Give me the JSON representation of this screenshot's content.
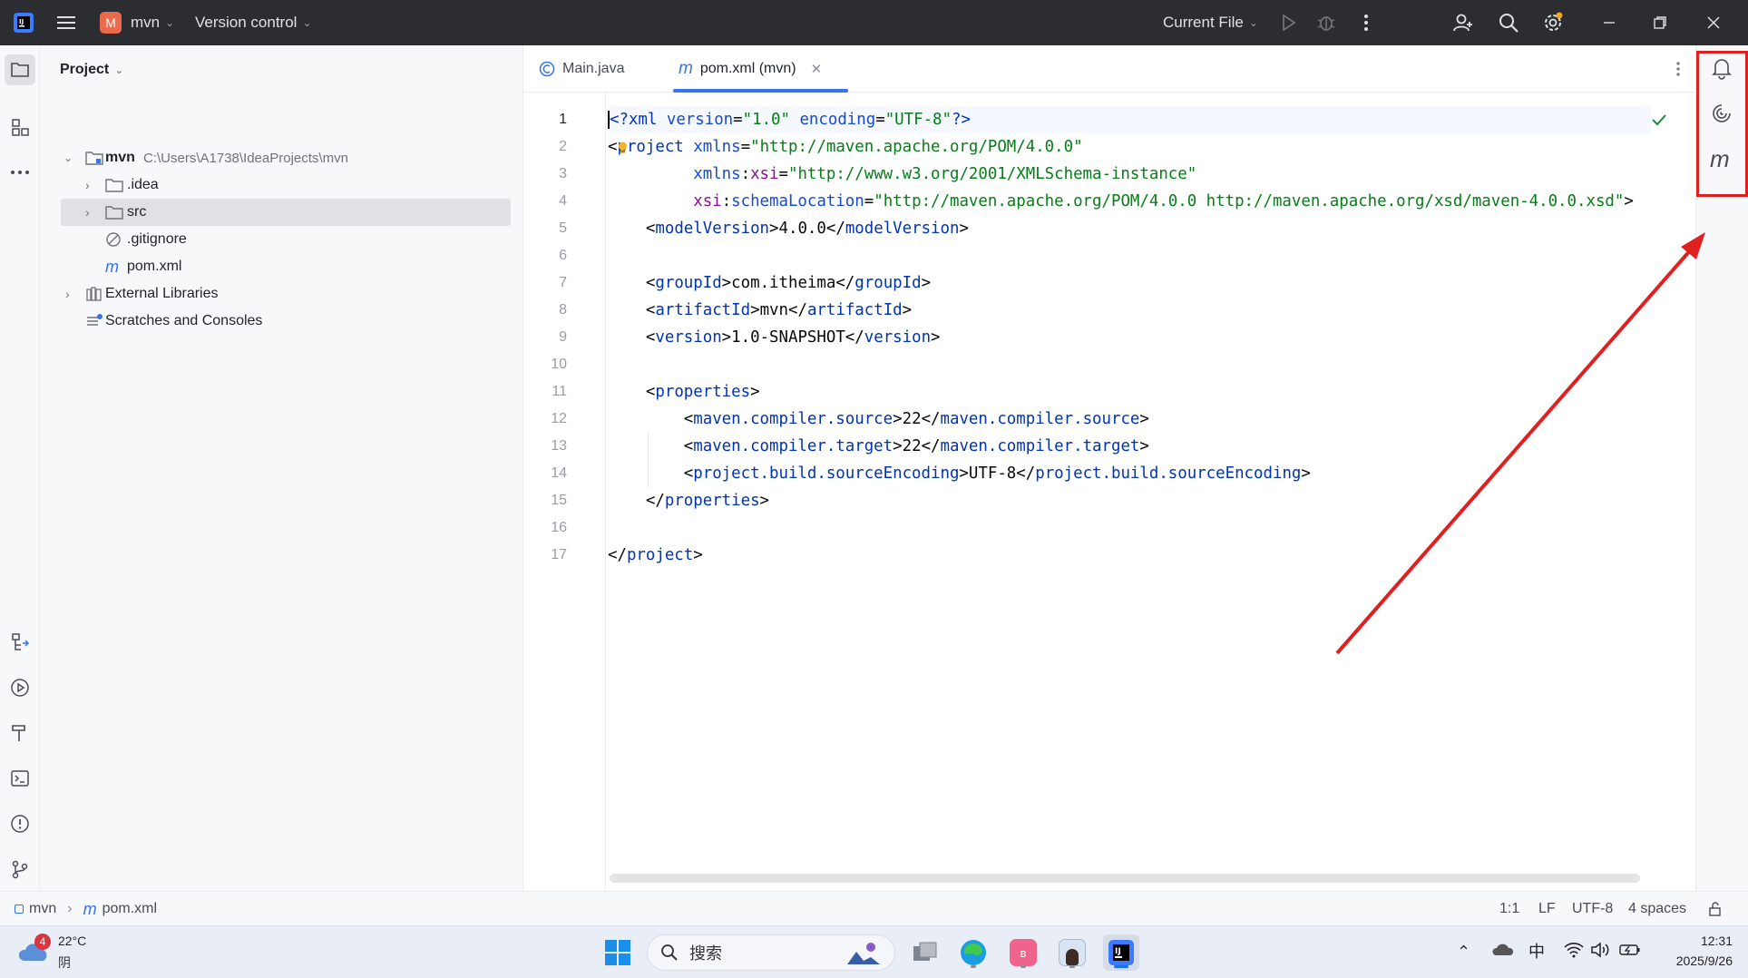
{
  "titlebar": {
    "project_badge": "M",
    "project_name": "mvn",
    "vcs_label": "Version control",
    "run_config": "Current File",
    "colors": {
      "badge": "#e96a4c",
      "bg": "#2b2d30"
    }
  },
  "project_panel": {
    "title": "Project",
    "tree": [
      {
        "label": "mvn",
        "path": "C:\\Users\\A1738\\IdeaProjects\\mvn",
        "icon": "module-folder-icon",
        "expanded": true
      },
      {
        "label": ".idea",
        "icon": "folder-icon",
        "expanded": false
      },
      {
        "label": "src",
        "icon": "folder-icon",
        "expanded": false,
        "selected": true
      },
      {
        "label": ".gitignore",
        "icon": "ignored-file-icon"
      },
      {
        "label": "pom.xml",
        "icon": "maven-file-icon"
      },
      {
        "label": "External Libraries",
        "icon": "library-icon",
        "expanded": false
      },
      {
        "label": "Scratches and Consoles",
        "icon": "scratches-icon"
      }
    ]
  },
  "editor": {
    "tabs": [
      {
        "label": "Main.java",
        "icon": "java-class-icon",
        "active": false
      },
      {
        "label": "pom.xml (mvn)",
        "icon": "maven-file-icon",
        "active": true
      }
    ],
    "line_numbers": [
      "1",
      "2",
      "3",
      "4",
      "5",
      "6",
      "7",
      "8",
      "9",
      "10",
      "11",
      "12",
      "13",
      "14",
      "15",
      "16",
      "17"
    ],
    "code": {
      "l1": {
        "a": "<?",
        "b": "xml",
        "c": " version",
        "d": "=",
        "e": "\"1.0\"",
        "f": " encoding",
        "g": "=",
        "h": "\"UTF-8\"",
        "i": "?>"
      },
      "l2": {
        "a": "<",
        "b": "project",
        "c": " xmlns",
        "d": "=",
        "e": "\"http://maven.apache.org/POM/4.0.0\""
      },
      "l3": {
        "indent": "         ",
        "a": "xmlns",
        "b": ":",
        "c": "xsi",
        "d": "=",
        "e": "\"http://www.w3.org/2001/XMLSchema-instance\""
      },
      "l4": {
        "indent": "         ",
        "a": "xsi",
        "b": ":",
        "c": "schemaLocation",
        "d": "=",
        "e": "\"http://maven.apache.org/POM/4.0.0 http://maven.apache.org/xsd/maven-4.0.0.xsd\"",
        "f": ">"
      },
      "l5": {
        "indent": "    ",
        "a": "<",
        "b": "modelVersion",
        "c": ">",
        "d": "4.0.0",
        "e": "</",
        "f": "modelVersion",
        "g": ">"
      },
      "l7": {
        "indent": "    ",
        "a": "<",
        "b": "groupId",
        "c": ">",
        "d": "com.itheima",
        "e": "</",
        "f": "groupId",
        "g": ">"
      },
      "l8": {
        "indent": "    ",
        "a": "<",
        "b": "artifactId",
        "c": ">",
        "d": "mvn",
        "e": "</",
        "f": "artifactId",
        "g": ">"
      },
      "l9": {
        "indent": "    ",
        "a": "<",
        "b": "version",
        "c": ">",
        "d": "1.0-SNAPSHOT",
        "e": "</",
        "f": "version",
        "g": ">"
      },
      "l11": {
        "indent": "    ",
        "a": "<",
        "b": "properties",
        "c": ">"
      },
      "l12": {
        "indent": "        ",
        "a": "<",
        "b": "maven.compiler.source",
        "c": ">",
        "d": "22",
        "e": "</",
        "f": "maven.compiler.source",
        "g": ">"
      },
      "l13": {
        "indent": "        ",
        "a": "<",
        "b": "maven.compiler.target",
        "c": ">",
        "d": "22",
        "e": "</",
        "f": "maven.compiler.target",
        "g": ">"
      },
      "l14": {
        "indent": "        ",
        "a": "<",
        "b": "project.build.sourceEncoding",
        "c": ">",
        "d": "UTF-8",
        "e": "</",
        "f": "project.build.sourceEncoding",
        "g": ">"
      },
      "l15": {
        "indent": "    ",
        "a": "</",
        "b": "properties",
        "c": ">"
      },
      "l17": {
        "a": "</",
        "b": "project",
        "c": ">"
      }
    }
  },
  "right_strip": {
    "items": [
      "notifications-icon",
      "ai-assistant-icon",
      "maven-icon"
    ]
  },
  "statusbar": {
    "breadcrumb": [
      "mvn",
      "pom.xml"
    ],
    "position": "1:1",
    "line_sep": "LF",
    "encoding": "UTF-8",
    "indent": "4 spaces"
  },
  "taskbar": {
    "weather_badge": "4",
    "temperature": "22°C",
    "condition": "阴",
    "search_placeholder": "搜索",
    "ime": "中",
    "time": "12:31",
    "date": "2025/9/26"
  },
  "annotation": {
    "color": "#e02020"
  }
}
